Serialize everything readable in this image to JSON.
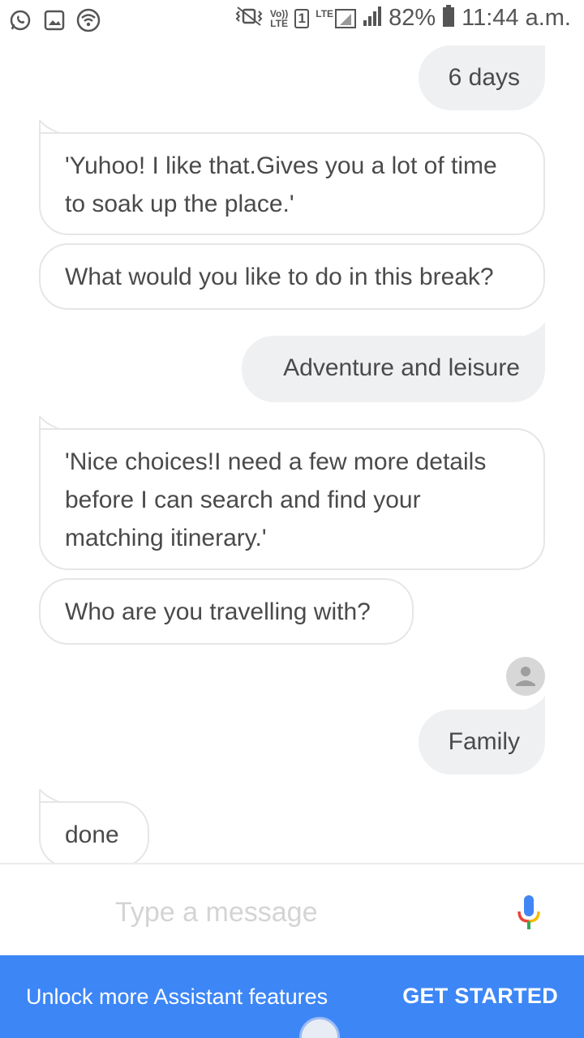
{
  "status_bar": {
    "vo_lte": "Vo))",
    "lte_small": "LTE",
    "sim_slot": "1",
    "lte": "LTE",
    "battery": "82%",
    "time": "11:44 a.m."
  },
  "chat": {
    "messages": [
      {
        "from": "user",
        "text": "6 days"
      },
      {
        "from": "bot",
        "text": "'Yuhoo! I like that.Gives you a lot of time to soak up the place.'"
      },
      {
        "from": "bot",
        "text": "What would you like to do in this break?"
      },
      {
        "from": "user",
        "text": "Adventure and leisure"
      },
      {
        "from": "bot",
        "text": "'Nice choices!I need a few more details before I can search and find your matching itinerary.'"
      },
      {
        "from": "bot",
        "text": "Who are you travelling with?"
      },
      {
        "from": "user",
        "text": "Family"
      },
      {
        "from": "bot",
        "text": "done"
      }
    ]
  },
  "input": {
    "placeholder": "Type a message",
    "value": ""
  },
  "promo": {
    "text": "Unlock more Assistant features",
    "button": "GET STARTED"
  },
  "colors": {
    "accent_blue": "#3d86f6",
    "user_bubble": "#eef0f2",
    "bot_border": "#e6e6e6"
  }
}
